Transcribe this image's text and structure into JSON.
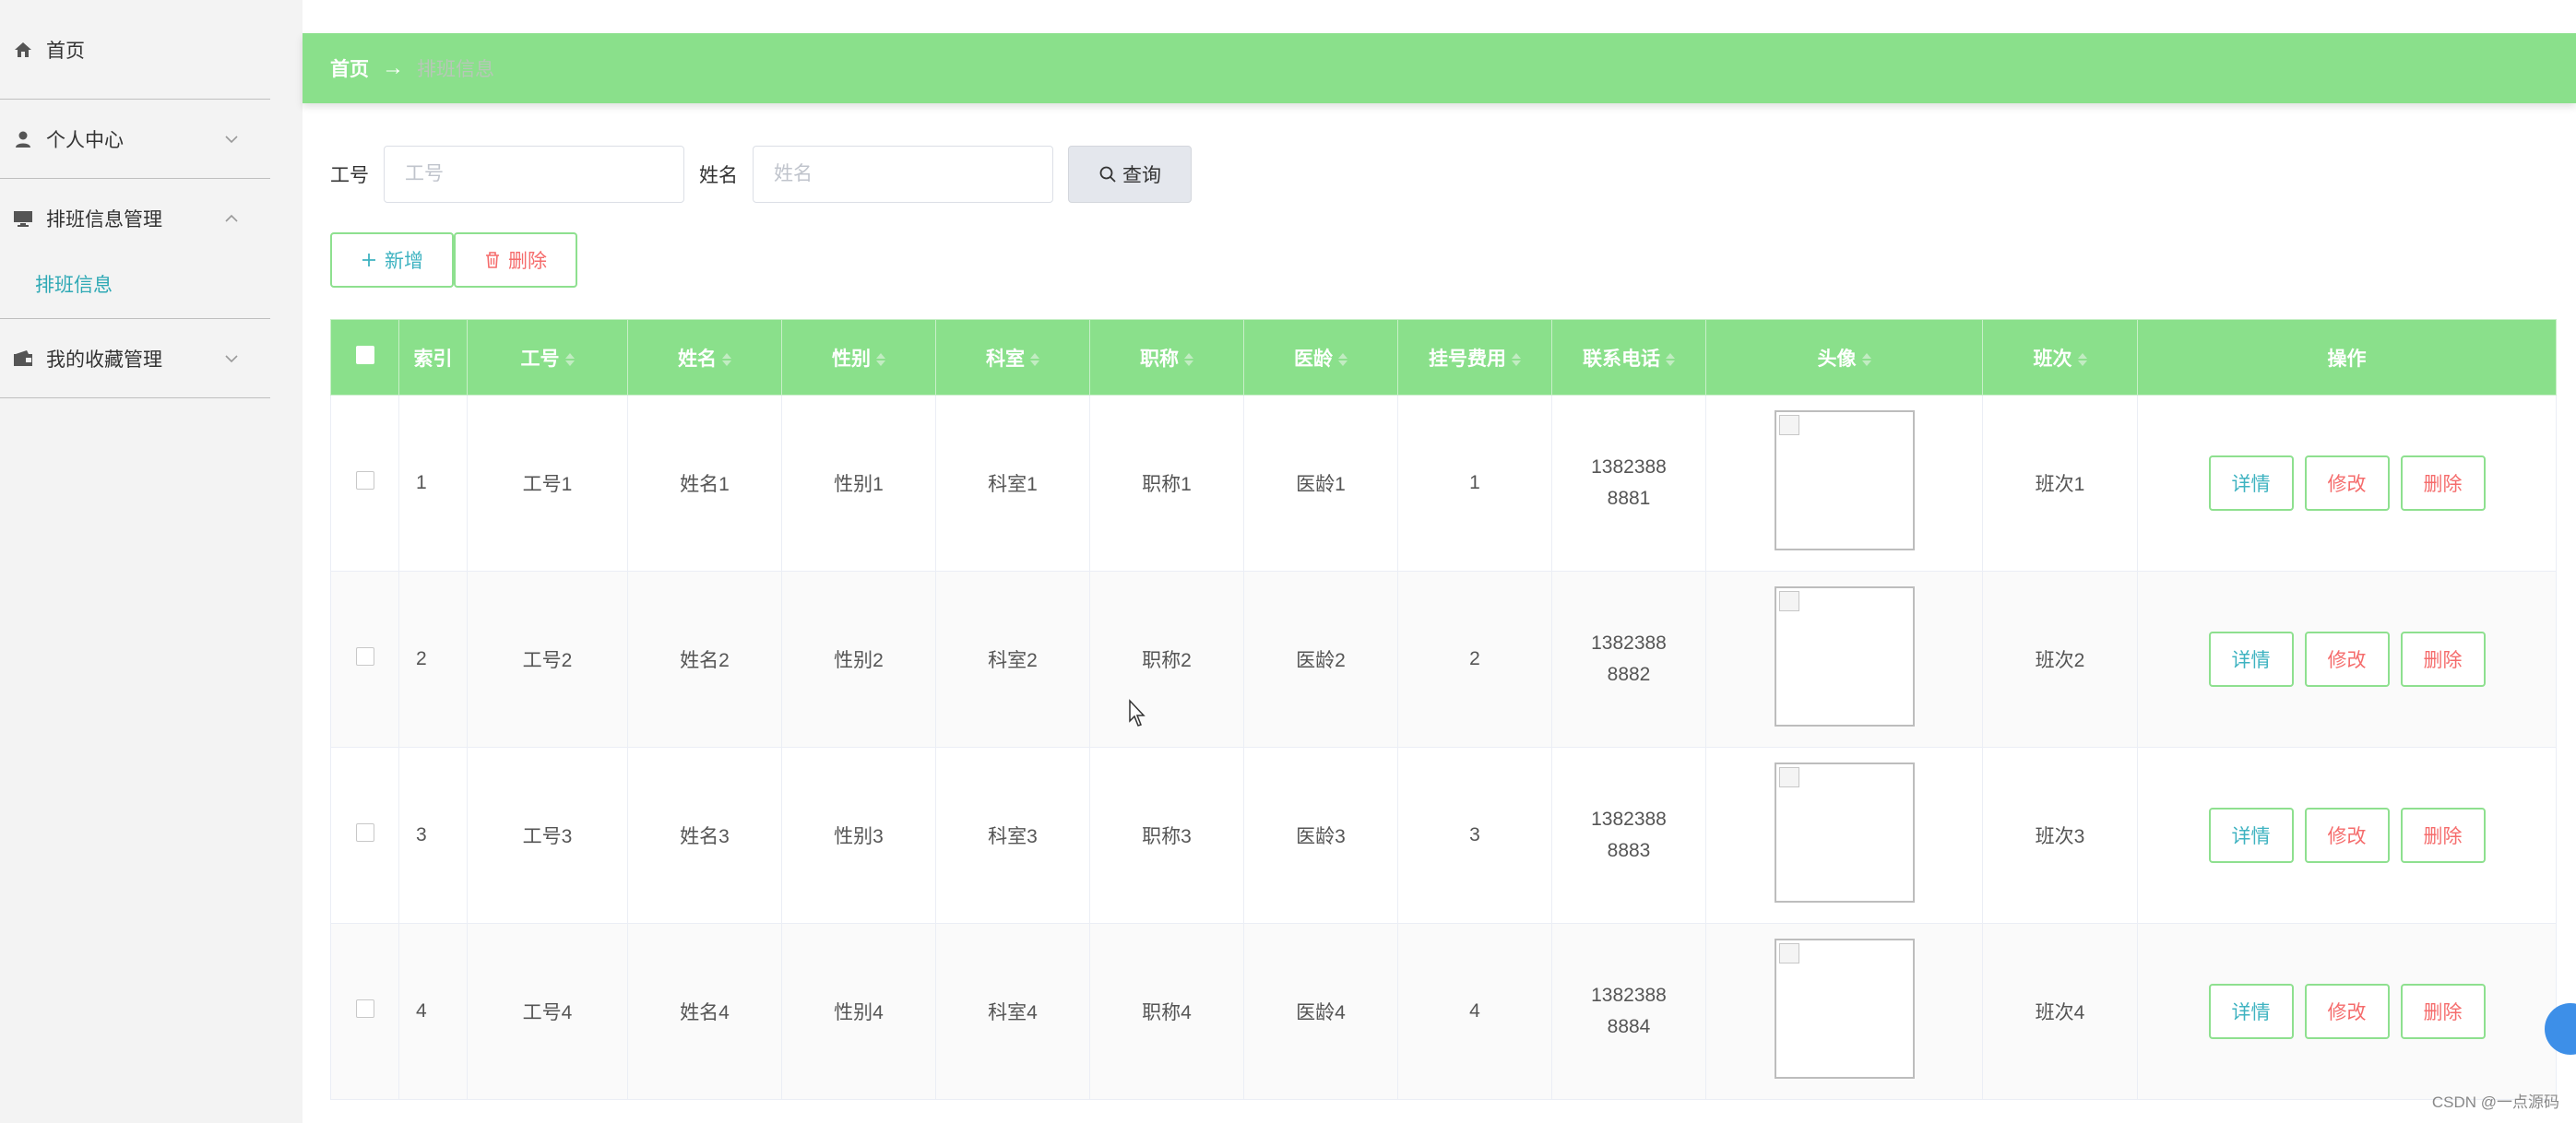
{
  "sidebar": {
    "items": [
      {
        "label": "首页"
      },
      {
        "label": "个人中心"
      },
      {
        "label": "排班信息管理"
      },
      {
        "label": "我的收藏管理"
      }
    ],
    "submenu_active": "排班信息"
  },
  "breadcrumb": {
    "home": "首页",
    "arrow": "→",
    "current": "排班信息"
  },
  "search": {
    "field1_label": "工号",
    "field1_placeholder": "工号",
    "field2_label": "姓名",
    "field2_placeholder": "姓名",
    "button": "查询"
  },
  "actions": {
    "add": "新增",
    "delete": "删除"
  },
  "table": {
    "headers": [
      "索引",
      "工号",
      "姓名",
      "性别",
      "科室",
      "职称",
      "医龄",
      "挂号费用",
      "联系电话",
      "头像",
      "班次",
      "操作"
    ],
    "rows": [
      {
        "idx": "1",
        "gonghao": "工号1",
        "name": "姓名1",
        "gender": "性别1",
        "dept": "科室1",
        "title": "职称1",
        "age": "医龄1",
        "fee": "1",
        "phone": "13823888881",
        "shift": "班次1"
      },
      {
        "idx": "2",
        "gonghao": "工号2",
        "name": "姓名2",
        "gender": "性别2",
        "dept": "科室2",
        "title": "职称2",
        "age": "医龄2",
        "fee": "2",
        "phone": "13823888882",
        "shift": "班次2"
      },
      {
        "idx": "3",
        "gonghao": "工号3",
        "name": "姓名3",
        "gender": "性别3",
        "dept": "科室3",
        "title": "职称3",
        "age": "医龄3",
        "fee": "3",
        "phone": "13823888883",
        "shift": "班次3"
      },
      {
        "idx": "4",
        "gonghao": "工号4",
        "name": "姓名4",
        "gender": "性别4",
        "dept": "科室4",
        "title": "职称4",
        "age": "医龄4",
        "fee": "4",
        "phone": "13823888884",
        "shift": "班次4"
      }
    ],
    "op_labels": {
      "detail": "详情",
      "edit": "修改",
      "delete": "删除"
    }
  },
  "watermark": "CSDN @一点源码",
  "colors": {
    "header_green": "#8ae08b",
    "accent_teal": "#3fb3c1",
    "danger": "#f56c6c"
  }
}
